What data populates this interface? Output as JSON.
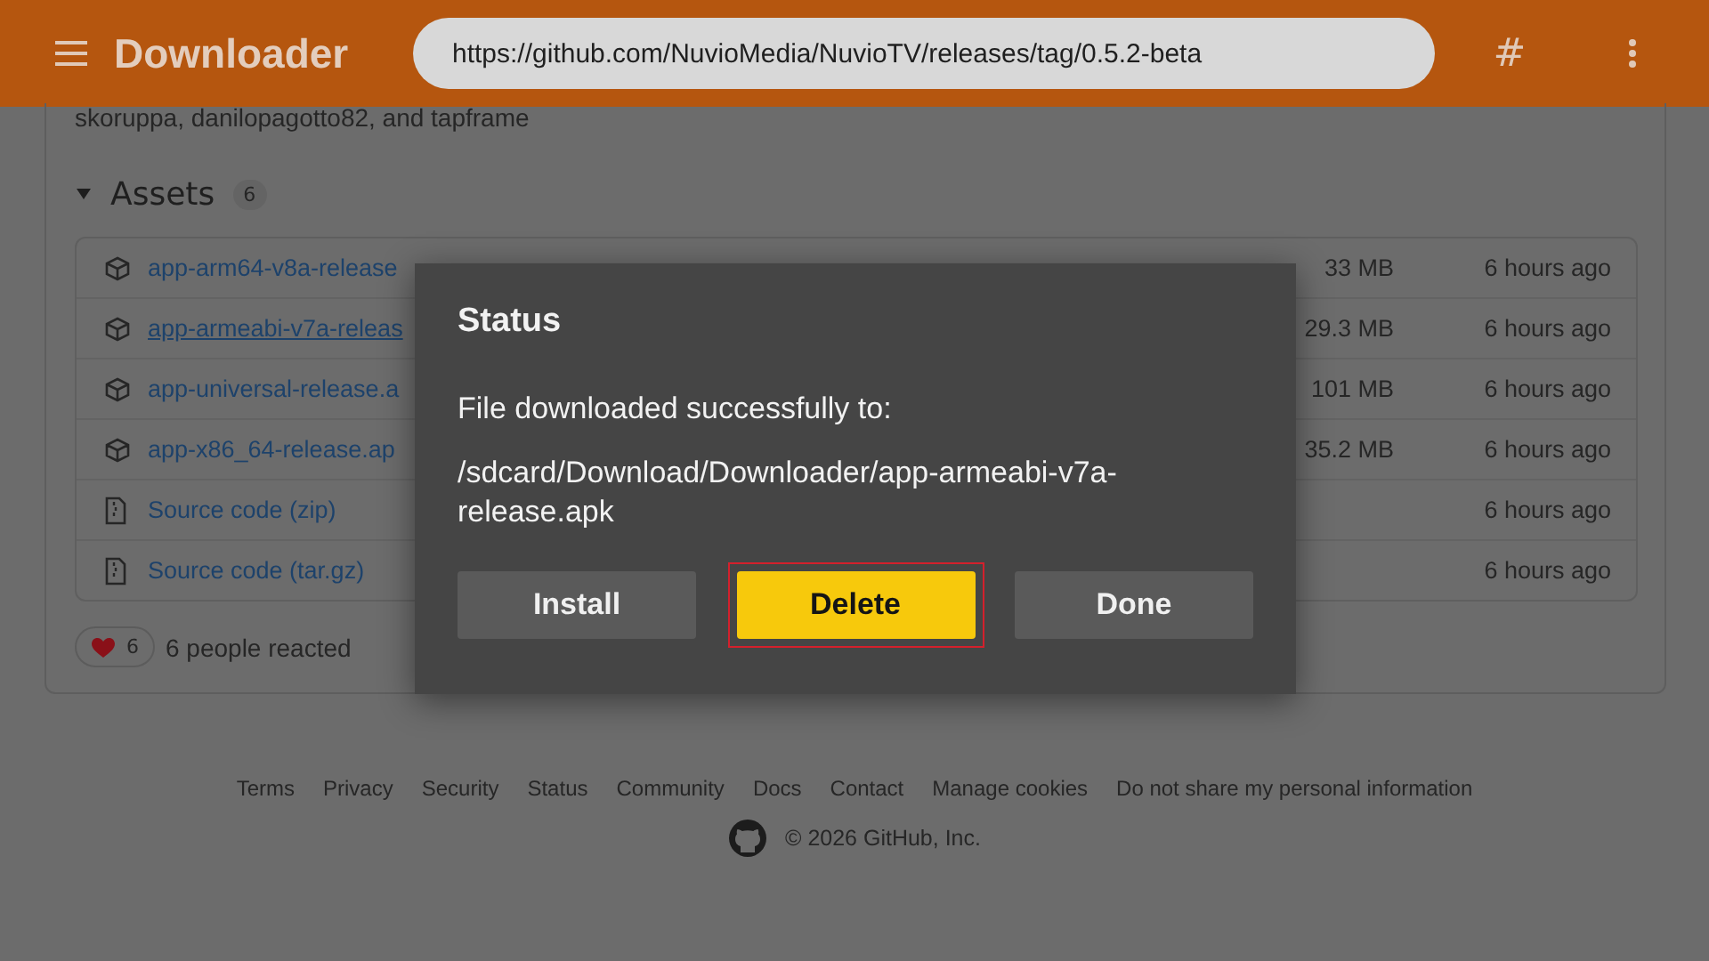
{
  "app_bar": {
    "title": "Downloader",
    "url": "https://github.com/NuvioMedia/NuvioTV/releases/tag/0.5.2-beta",
    "shortcut": "#"
  },
  "page": {
    "contributors": "skoruppa, danilopagotto82, and tapframe",
    "assets": {
      "title": "Assets",
      "count": "6",
      "expanded": true,
      "rows": [
        {
          "kind": "package",
          "name": "app-arm64-v8a-release",
          "focused": false,
          "size": "33 MB",
          "time": "6 hours ago"
        },
        {
          "kind": "package",
          "name": "app-armeabi-v7a-releas",
          "focused": true,
          "size": "29.3 MB",
          "time": "6 hours ago"
        },
        {
          "kind": "package",
          "name": "app-universal-release.a",
          "focused": false,
          "size": "101 MB",
          "time": "6 hours ago"
        },
        {
          "kind": "package",
          "name": "app-x86_64-release.ap",
          "focused": false,
          "size": "35.2 MB",
          "time": "6 hours ago"
        },
        {
          "kind": "archive",
          "name": "Source code (zip)",
          "focused": false,
          "time": "6 hours ago"
        },
        {
          "kind": "archive",
          "name": "Source code (tar.gz)",
          "focused": false,
          "time": "6 hours ago"
        }
      ]
    },
    "reaction": {
      "count": "6",
      "text": "6 people reacted"
    },
    "footer": {
      "links": [
        "Terms",
        "Privacy",
        "Security",
        "Status",
        "Community",
        "Docs",
        "Contact",
        "Manage cookies",
        "Do not share my personal information"
      ],
      "copyright": "© 2026 GitHub, Inc."
    }
  },
  "dialog": {
    "title": "Status",
    "message": "File downloaded successfully to:",
    "path": "/sdcard/Download/Downloader/app-armeabi-v7a-release.apk",
    "buttons": [
      {
        "label": "Install",
        "selected": false
      },
      {
        "label": "Delete",
        "selected": true
      },
      {
        "label": "Done",
        "selected": false
      }
    ]
  }
}
